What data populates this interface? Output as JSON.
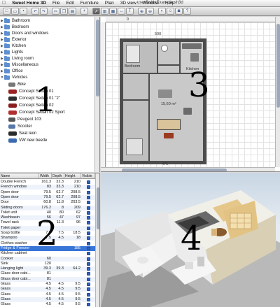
{
  "menubar": {
    "apple": "",
    "app_name": "Sweet Home 3D",
    "items": [
      "File",
      "Edit",
      "Furniture",
      "Plan",
      "3D view",
      "Window",
      "Help"
    ],
    "document_title": "userGuideExample.sh3d"
  },
  "catalog": {
    "categories": [
      "Bathroom",
      "Bedroom",
      "Doors and windows",
      "Exterior",
      "Kitchen",
      "Lights",
      "Living room",
      "Miscellaneous",
      "Office"
    ],
    "open_category": "Vehicles",
    "vehicles": [
      "Bike",
      "Concept Sedan 01",
      "Concept Sedan 01 \"2\"",
      "Concept Sedan 02",
      "Concept Sedan 02 Sport",
      "Peugeot 103",
      "Scooter",
      "Seat leon",
      "VW new beetle"
    ]
  },
  "furniture_table": {
    "columns": [
      "Name",
      "Width",
      "Depth",
      "Height",
      "Visible"
    ],
    "rows": [
      {
        "name": "Double French",
        "w": "161.3",
        "d": "32.3",
        "h": "210"
      },
      {
        "name": "French window",
        "w": "83",
        "d": "33.3",
        "h": "210"
      },
      {
        "name": "Open door",
        "w": "79.5",
        "d": "62.7",
        "h": "208.5"
      },
      {
        "name": "Open door",
        "w": "79.5",
        "d": "62.7",
        "h": "208.5"
      },
      {
        "name": "Door",
        "w": "60.8",
        "d": "11.8",
        "h": "203.5"
      },
      {
        "name": "Sliding doors",
        "w": "176.2",
        "d": "8",
        "h": "209"
      },
      {
        "name": "Toilet unit",
        "w": "40",
        "d": "80",
        "h": "62"
      },
      {
        "name": "Washbasin",
        "w": "56",
        "d": "47",
        "h": "97"
      },
      {
        "name": "Towel rack",
        "w": "56.5",
        "d": "11.3",
        "h": "96"
      },
      {
        "name": "Toilet paper",
        "w": "",
        "d": "",
        "h": ""
      },
      {
        "name": "Soap bottle",
        "w": "7.5",
        "d": "7.5",
        "h": "18.5"
      },
      {
        "name": "Shampoo",
        "w": "7.5",
        "d": "4.5",
        "h": "18"
      },
      {
        "name": "Clothes washer",
        "w": "",
        "d": "",
        "h": ""
      },
      {
        "name": "Fridge & Freezer",
        "w": "",
        "d": "",
        "h": "185"
      },
      {
        "name": "Kitchen cabinet",
        "w": "",
        "d": "",
        "h": ""
      },
      {
        "name": "Cooker",
        "w": "60",
        "d": "",
        "h": ""
      },
      {
        "name": "Sink",
        "w": "120",
        "d": "",
        "h": ""
      },
      {
        "name": "Hanging light",
        "w": "39.3",
        "d": "39.3",
        "h": "64.2"
      },
      {
        "name": "Glass door cabi...",
        "w": "81",
        "d": "",
        "h": ""
      },
      {
        "name": "Glass door cabi...",
        "w": "81",
        "d": "",
        "h": ""
      },
      {
        "name": "Glass",
        "w": "4.5",
        "d": "4.5",
        "h": "9.5"
      },
      {
        "name": "Glass",
        "w": "4.5",
        "d": "4.5",
        "h": "9.5"
      },
      {
        "name": "Glass",
        "w": "4.5",
        "d": "4.5",
        "h": "9.5"
      },
      {
        "name": "Glass",
        "w": "4.5",
        "d": "4.5",
        "h": "9.5"
      },
      {
        "name": "Glass",
        "w": "4.5",
        "d": "4.5",
        "h": "9.5"
      }
    ],
    "selected_index": 13
  },
  "plan": {
    "top_ruler_label": "0",
    "top_dim": "500",
    "bottom_dim": "471",
    "room_labels": [
      "Kitchen",
      "Bedroom"
    ],
    "room_label_area": "15,60 m²"
  },
  "overlay_numbers": [
    "1",
    "2",
    "3",
    "4"
  ]
}
